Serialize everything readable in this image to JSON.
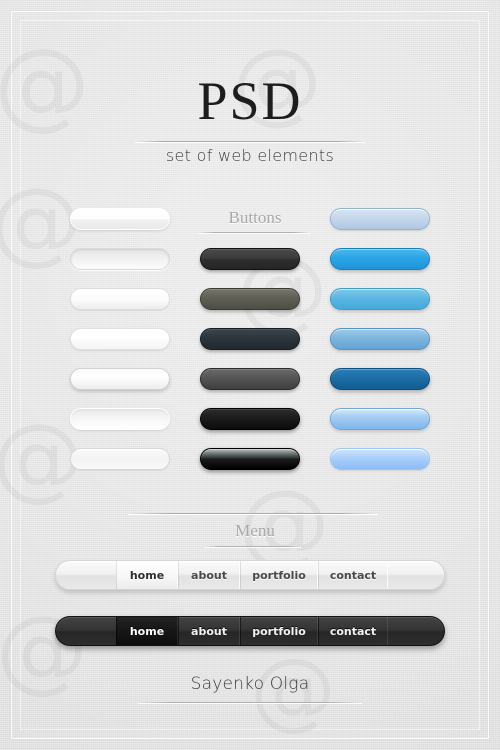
{
  "header": {
    "title": "PSD",
    "subtitle": "set of web elements"
  },
  "sections": {
    "buttons_label": "Buttons",
    "menu_label": "Menu"
  },
  "colors": {
    "page_background": "#e9e9e9",
    "title_text": "#1d1d1d",
    "section_label": "#a9a9a9",
    "accent_blue": "#2ba4e6",
    "deep_blue": "#1d6ea6",
    "dark_button": "#2e2e2e"
  },
  "buttons": {
    "columns": [
      "light",
      "dark",
      "blue"
    ],
    "rows": [
      {
        "light": {
          "name": "light-button-1",
          "style": "glossy-white",
          "fill": "#ffffff"
        },
        "dark": null,
        "blue": {
          "name": "blue-button-1",
          "style": "pale-steel",
          "fill": "#c3d6ea"
        }
      },
      {
        "light": {
          "name": "light-button-2",
          "style": "inset-gray",
          "fill": "#efefef"
        },
        "dark": {
          "name": "dark-button-1",
          "style": "charcoal",
          "fill": "#3b3b3b"
        },
        "blue": {
          "name": "blue-button-2",
          "style": "bright-azure",
          "fill": "#2ba4e6"
        }
      },
      {
        "light": {
          "name": "light-button-3",
          "style": "soft-white",
          "fill": "#fbfbfb"
        },
        "dark": {
          "name": "dark-button-2",
          "style": "olive-gray",
          "fill": "#5f5f55"
        },
        "blue": {
          "name": "blue-button-3",
          "style": "sky-blue",
          "fill": "#59b6e2"
        }
      },
      {
        "light": {
          "name": "light-button-4",
          "style": "bright-white",
          "fill": "#ffffff"
        },
        "dark": {
          "name": "dark-button-3",
          "style": "slate-blue-gray",
          "fill": "#2d353c"
        },
        "blue": {
          "name": "blue-button-4",
          "style": "muted-blue",
          "fill": "#7bb4de"
        }
      },
      {
        "light": {
          "name": "light-button-5",
          "style": "raised-white",
          "fill": "#ffffff"
        },
        "dark": {
          "name": "dark-button-4",
          "style": "medium-gray",
          "fill": "#555555"
        },
        "blue": {
          "name": "blue-button-5",
          "style": "deep-ocean",
          "fill": "#1d6ea6"
        }
      },
      {
        "light": {
          "name": "light-button-6",
          "style": "outlined-white",
          "fill": "#f6f6f6"
        },
        "dark": {
          "name": "dark-button-5",
          "style": "near-black",
          "fill": "#1c1c1c"
        },
        "blue": {
          "name": "blue-button-6",
          "style": "glassy-light-blue",
          "fill": "#a9cff3"
        }
      },
      {
        "light": {
          "name": "light-button-7",
          "style": "flat-pale",
          "fill": "#f2f2f2"
        },
        "dark": {
          "name": "dark-button-6",
          "style": "chrome-to-black",
          "fill": "#0c0c0c"
        },
        "blue": {
          "name": "blue-button-7",
          "style": "periwinkle",
          "fill": "#a9cffa"
        }
      }
    ]
  },
  "menus": {
    "light_nav": {
      "items": [
        {
          "label": "home",
          "active": true
        },
        {
          "label": "about",
          "active": false
        },
        {
          "label": "portfolio",
          "active": false
        },
        {
          "label": "contact",
          "active": false
        }
      ]
    },
    "dark_nav": {
      "items": [
        {
          "label": "home",
          "active": true
        },
        {
          "label": "about",
          "active": false
        },
        {
          "label": "portfolio",
          "active": false
        },
        {
          "label": "contact",
          "active": false
        }
      ]
    }
  },
  "footer": {
    "author": "Sayenko Olga"
  },
  "watermarks": {
    "glyph": "@"
  }
}
